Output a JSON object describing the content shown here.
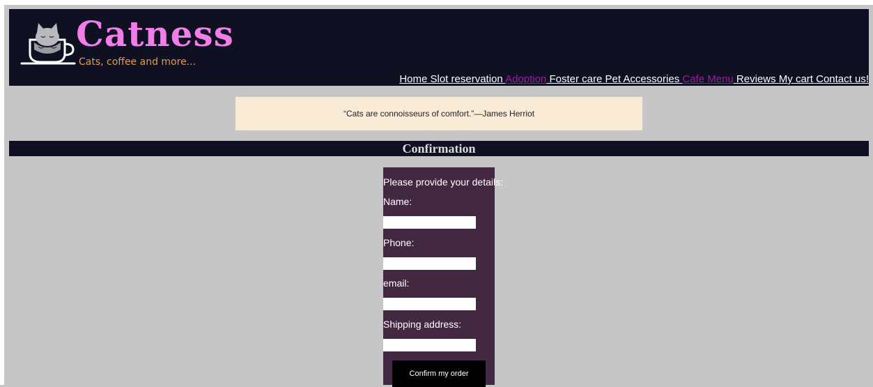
{
  "brand": {
    "name": "Catness",
    "tagline": "Cats, coffee and more..."
  },
  "nav": {
    "items": [
      {
        "label": "Home",
        "visited": false
      },
      {
        "label": "Slot reservation",
        "visited": false
      },
      {
        "label": "Adoption",
        "visited": true
      },
      {
        "label": "Foster care",
        "visited": false
      },
      {
        "label": "Pet Accessories",
        "visited": false
      },
      {
        "label": "Cafe Menu",
        "visited": true
      },
      {
        "label": "Reviews",
        "visited": false
      },
      {
        "label": "My cart",
        "visited": false
      },
      {
        "label": "Contact us!",
        "visited": false
      }
    ]
  },
  "quote": {
    "text": "“Cats are connoisseurs of comfort.”—James Herriot"
  },
  "section": {
    "title": "Confirmation"
  },
  "form": {
    "intro": "Please provide your details:",
    "name_label": "Name:",
    "name_value": "",
    "phone_label": "Phone:",
    "phone_value": "",
    "email_label": "email:",
    "email_value": "",
    "address_label": "Shipping address:",
    "address_value": "",
    "submit_label": "Confirm my order"
  },
  "colors": {
    "header_bg": "#0f1123",
    "brand": "#f17de9",
    "tagline": "#e09b52",
    "visited_link": "#9a1da3",
    "quote_bg": "#faebd7",
    "form_bg": "#432842",
    "page_bg": "#c6c6c6"
  },
  "icons": {
    "logo": "cat-in-coffee-cup-icon"
  }
}
